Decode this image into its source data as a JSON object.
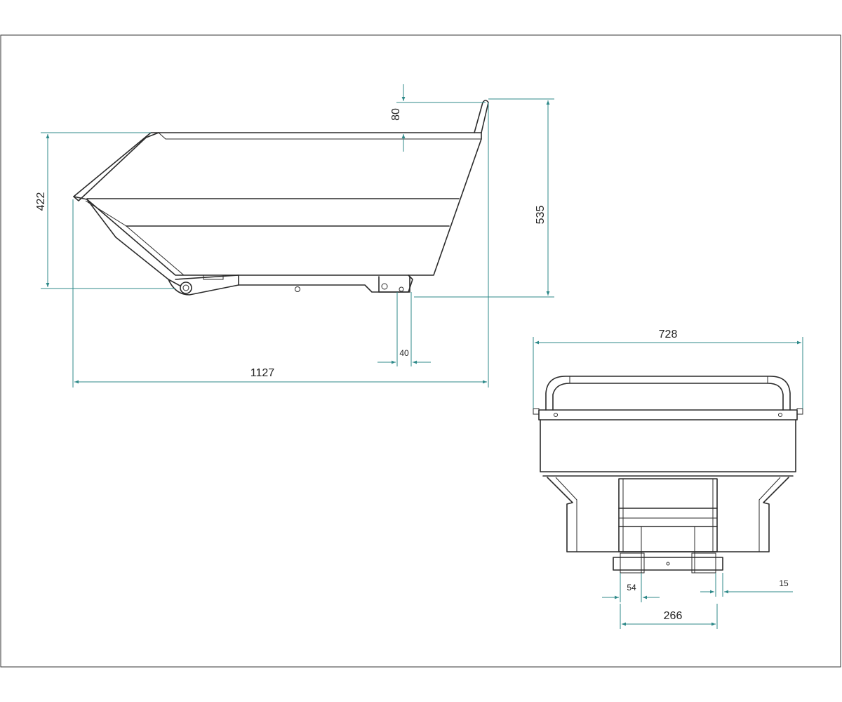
{
  "dimensions": {
    "side_height_body": "422",
    "side_handle_offset": "80",
    "side_total_height": "535",
    "side_total_length": "1127",
    "side_pocket_width": "40",
    "front_total_width": "728",
    "front_fork_pocket_width": "54",
    "front_pocket_spacing": "266",
    "front_plate_thickness": "15"
  },
  "colors": {
    "dimension_line": "#2f8a8a",
    "outline": "#2b2b2b",
    "background": "#ffffff"
  }
}
